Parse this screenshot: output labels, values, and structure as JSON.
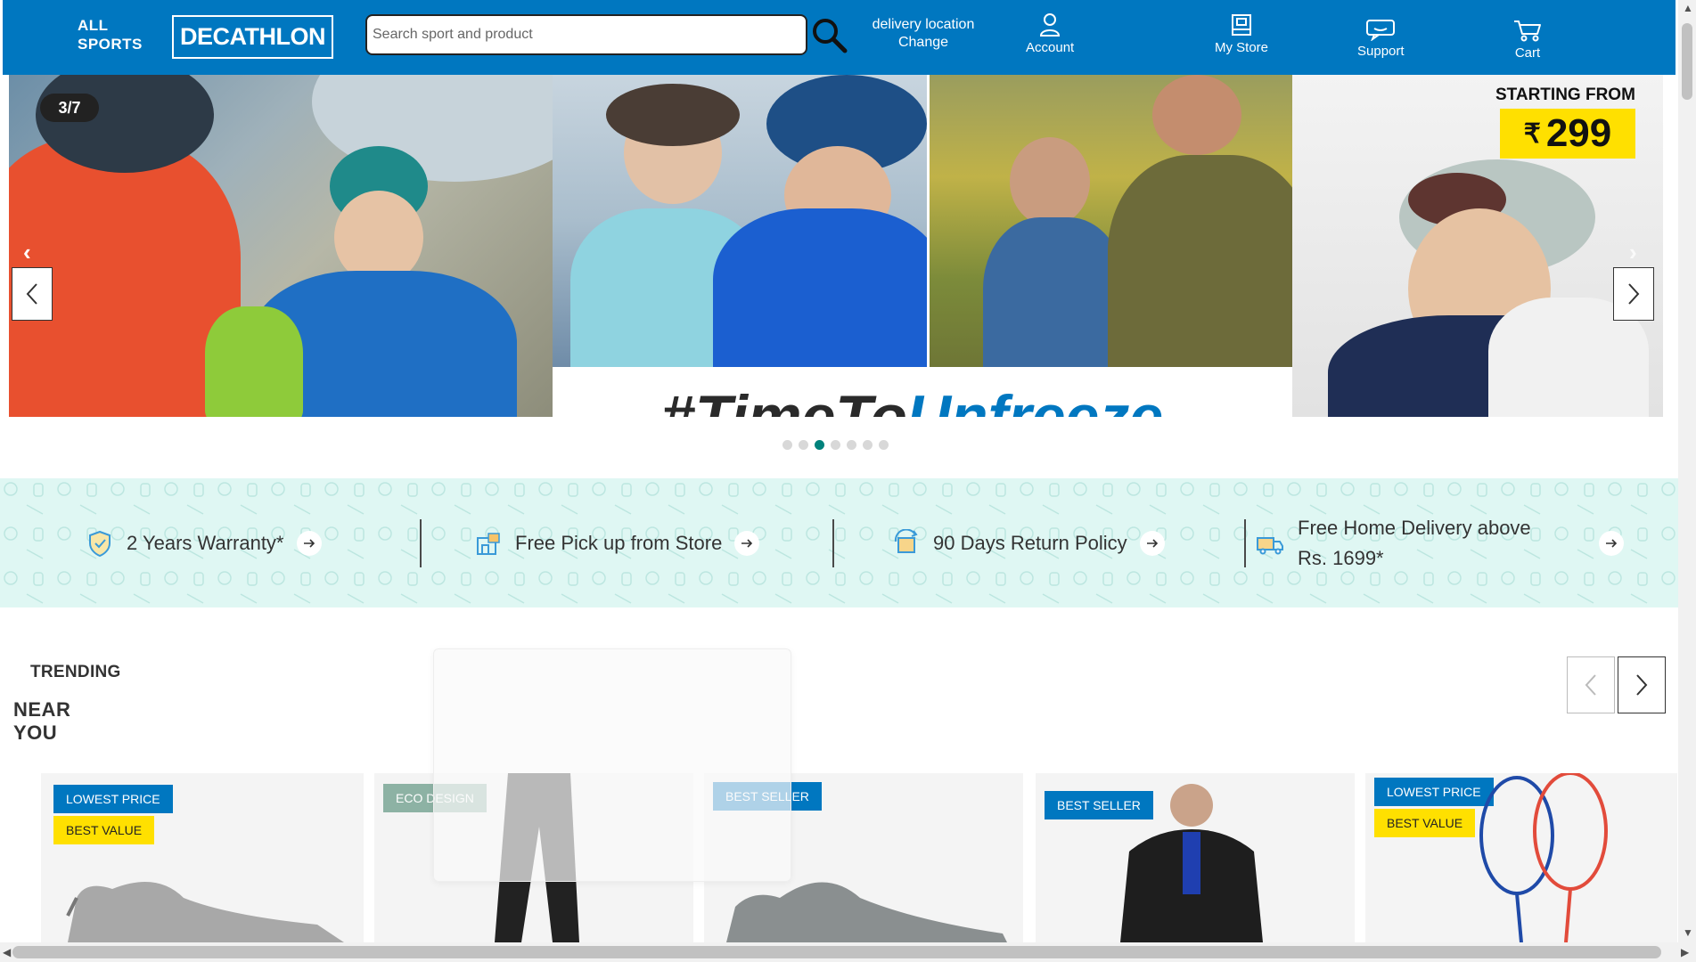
{
  "header": {
    "all_sports_line1": "ALL",
    "all_sports_line2": "SPORTS",
    "logo_text": "DECATHLON",
    "search_placeholder": "Search sport and product",
    "delivery_line1": "delivery location",
    "delivery_line2": "Change",
    "account_label": "Account",
    "store_label": "My Store",
    "support_label": "Support",
    "cart_label": "Cart",
    "brand_color": "#0077c0"
  },
  "hero": {
    "counter": "3/7",
    "tagline_part1": "#TimeTo",
    "tagline_part2": "Unfreeze",
    "starting_from": "STARTING FROM",
    "currency": "₹",
    "price": "299",
    "slide_count": 7,
    "active_slide": 3
  },
  "benefits": [
    {
      "text": "2 Years Warranty*",
      "icon": "shield-check-icon"
    },
    {
      "text": "Free Pick up from Store",
      "icon": "store-pickup-icon"
    },
    {
      "text": "90 Days Return Policy",
      "icon": "return-box-icon"
    },
    {
      "text": "Free Home Delivery above Rs. 1699*",
      "icon": "delivery-truck-icon"
    }
  ],
  "trending": {
    "title": "TRENDING",
    "subtitle_line1": "NEAR",
    "subtitle_line2": "YOU",
    "products": [
      {
        "badges": [
          "LOWEST PRICE",
          "BEST VALUE"
        ],
        "kind": "shoe"
      },
      {
        "badges": [
          "ECO DESIGN"
        ],
        "kind": "pants"
      },
      {
        "badges": [
          "BEST SELLER"
        ],
        "kind": "shoe"
      },
      {
        "badges": [
          "BEST SELLER"
        ],
        "kind": "jacket"
      },
      {
        "badges": [
          "LOWEST PRICE",
          "BEST VALUE"
        ],
        "kind": "racket"
      }
    ]
  },
  "colors": {
    "accent_green": "#00827c",
    "badge_blue": "#0077c0",
    "badge_yellow": "#ffe000",
    "badge_green": "#8db2a4",
    "benefit_bg": "#dff7f3"
  }
}
